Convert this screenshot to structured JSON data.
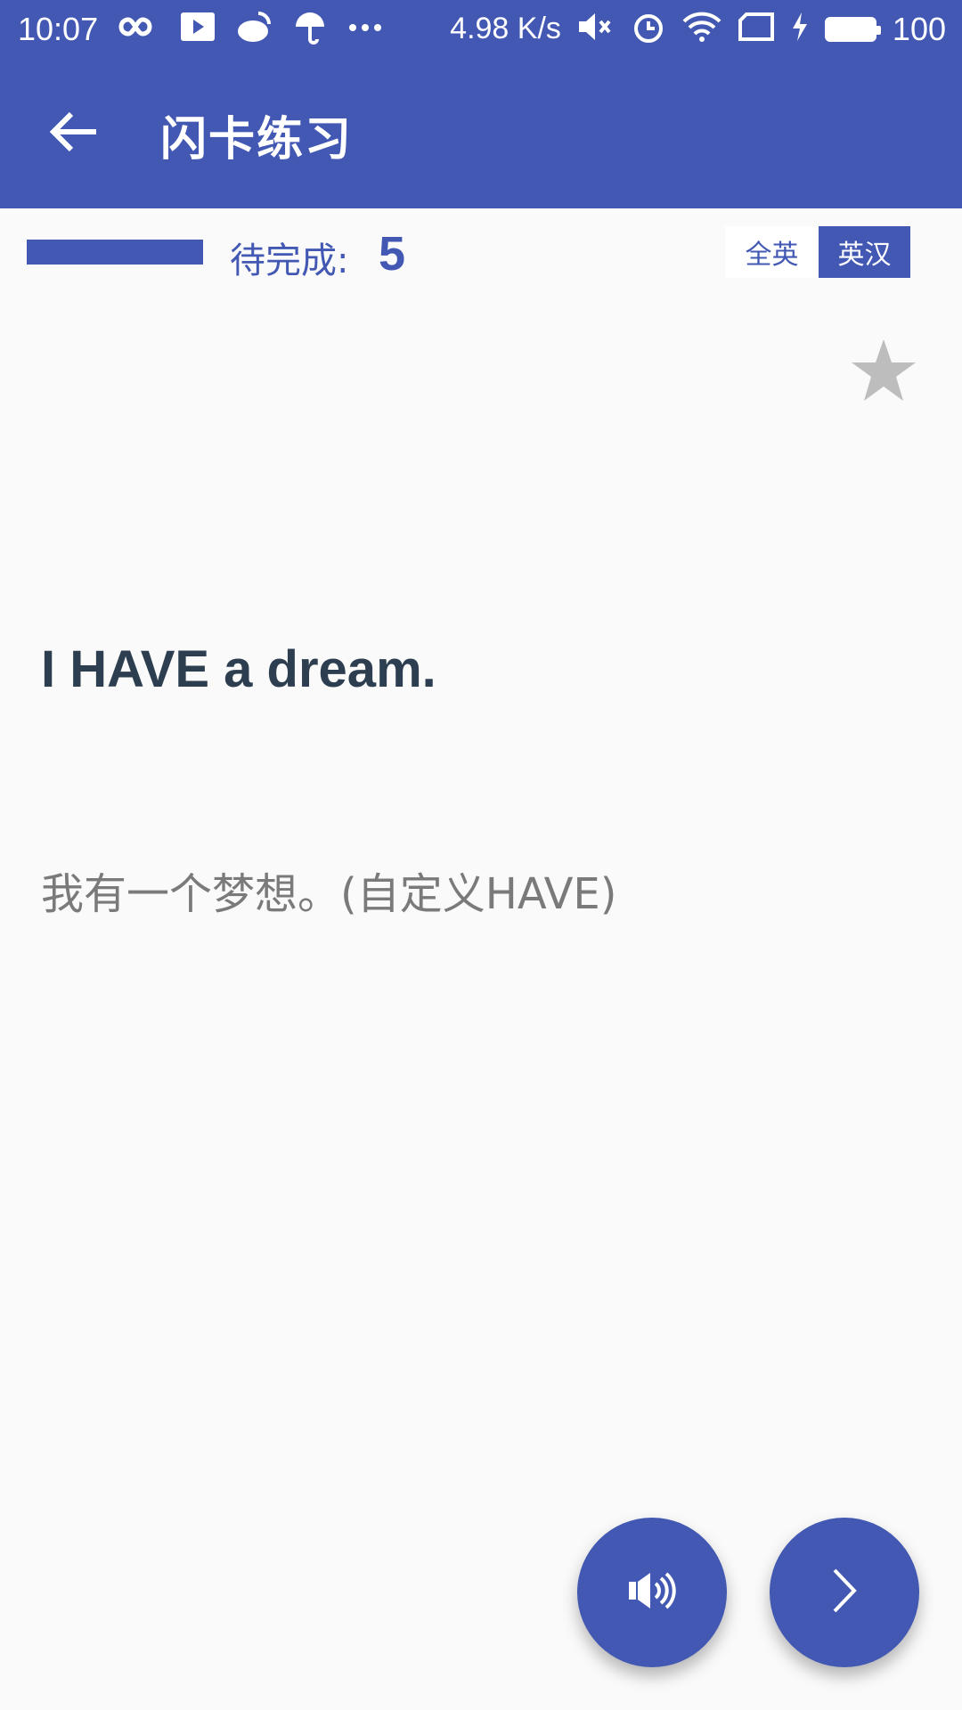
{
  "status_bar": {
    "time": "10:07",
    "speed": "4.98 K/s",
    "battery": "100",
    "icons_left": [
      "infinity-icon",
      "play-icon",
      "weibo-icon",
      "umbrella-icon",
      "more-dots-icon"
    ],
    "icons_right": [
      "mute-icon",
      "alarm-icon",
      "wifi-icon",
      "sim-icon",
      "charging-icon",
      "battery-icon"
    ]
  },
  "app_bar": {
    "title": "闪卡练习",
    "back_icon": "arrow-back-icon"
  },
  "progress": {
    "label": "待完成:",
    "count": "5",
    "fill_fraction": 1.0
  },
  "mode_toggle": {
    "options": [
      "全英",
      "英汉"
    ],
    "selected": "英汉"
  },
  "card": {
    "sentence": "I HAVE a dream.",
    "translation": "我有一个梦想。(自定义HAVE)",
    "favorite_icon": "star-icon"
  },
  "actions": {
    "sound_icon": "speaker-icon",
    "next_icon": "chevron-right-icon"
  },
  "colors": {
    "primary": "#4258b3",
    "background": "#fafafa",
    "sentence_text": "#2c3e50",
    "translation_text": "#7a7a7a",
    "star": "#bdbdbd"
  }
}
